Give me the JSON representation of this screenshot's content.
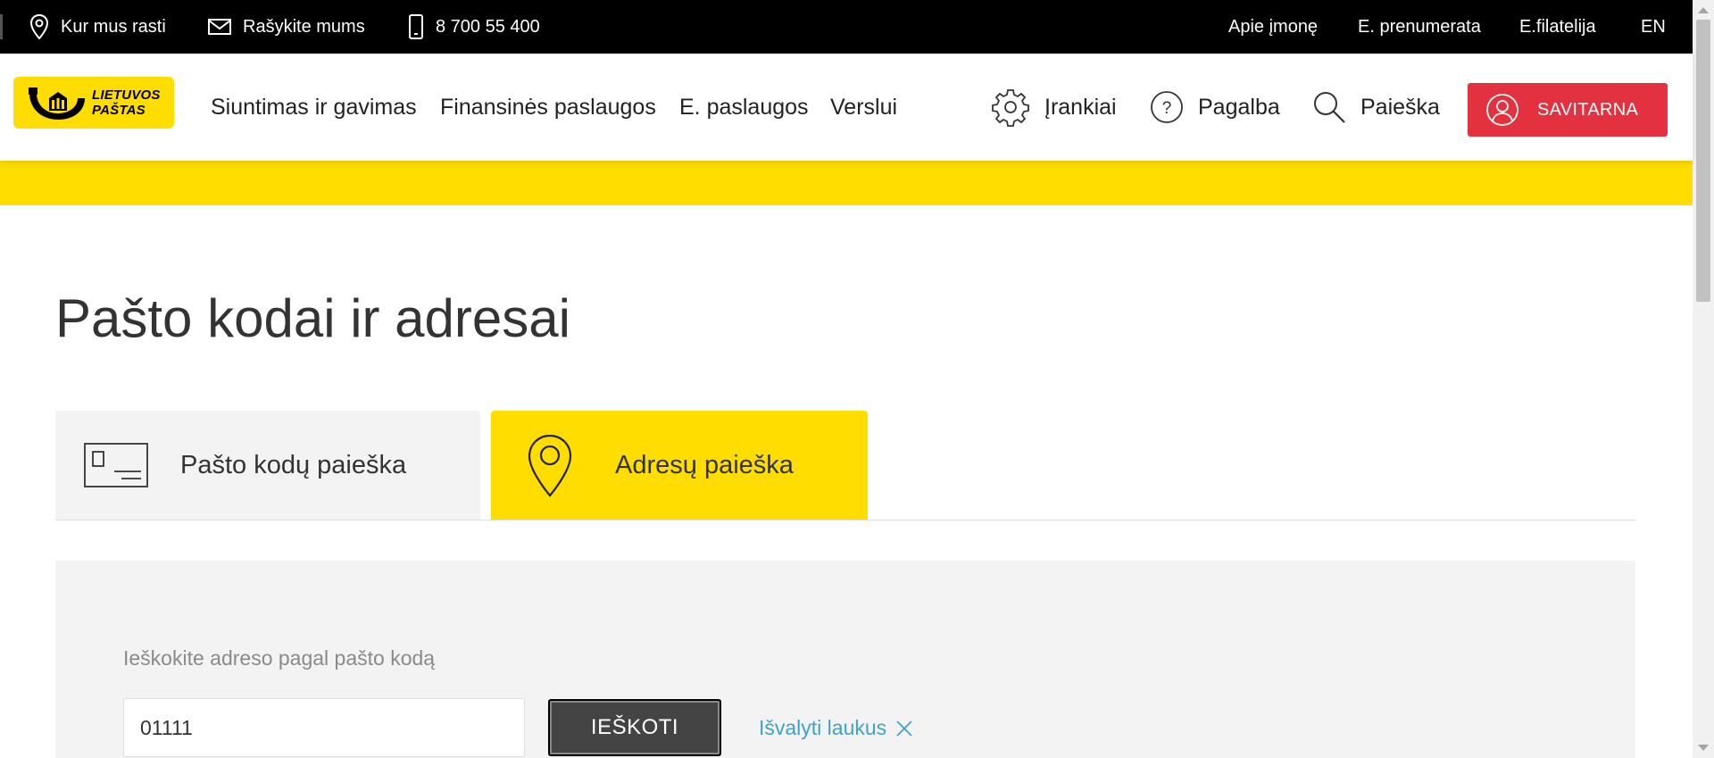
{
  "topbar": {
    "location_label": "Kur mus rasti",
    "write_label": "Rašykite mums",
    "phone_label": "8 700 55 400",
    "about_label": "Apie įmonę",
    "subscription_label": "E. prenumerata",
    "philately_label": "E.filatelija",
    "language_label": "EN"
  },
  "header": {
    "logo_line1": "LIETUVOS",
    "logo_line2": "PAŠTAS",
    "nav": {
      "shipping": "Siuntimas ir gavimas",
      "financial": "Finansinės paslaugos",
      "eservices": "E. paslaugos",
      "business": "Verslui"
    },
    "tools_label": "Įrankiai",
    "help_label": "Pagalba",
    "search_label": "Paieška",
    "selfservice_label": "SAVITARNA"
  },
  "page": {
    "title": "Pašto kodai ir adresai"
  },
  "tabs": {
    "postcode_search": "Pašto kodų paieška",
    "address_search": "Adresų paieška",
    "active": "address_search"
  },
  "search_form": {
    "label": "Ieškokite adreso pagal pašto kodą",
    "input_value": "01111",
    "submit_label": "IEŠKOTI",
    "clear_label": "Išvalyti laukus"
  },
  "colors": {
    "brand_yellow": "#FFDD00",
    "selfservice_red": "#E4313F",
    "link_blue": "#3FA2C6",
    "topbar_black": "#000000",
    "panel_gray": "#F3F3F3"
  },
  "icons": {
    "location": "location-pin-icon",
    "mail": "envelope-icon",
    "phone": "mobile-phone-icon",
    "tools": "gear-icon",
    "help": "question-circle-icon",
    "search": "magnifier-icon",
    "user": "user-circle-icon",
    "postcard": "postcard-icon",
    "address_pin": "map-pin-icon",
    "clear": "close-icon"
  }
}
